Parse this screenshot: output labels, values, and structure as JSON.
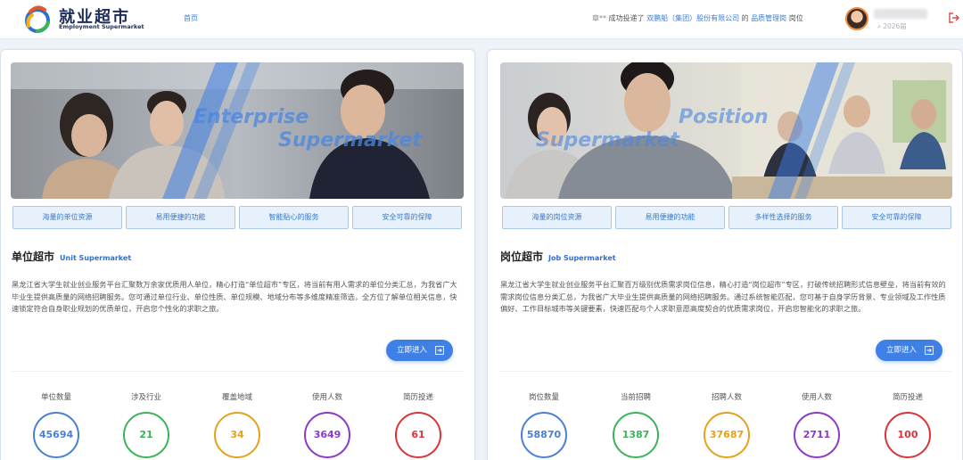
{
  "header": {
    "logo_title": "就业超市",
    "logo_subtitle": "Employment Supermarket",
    "nav_home": "首页",
    "ticker": {
      "user": "章**",
      "text1": "成功投递了",
      "company": "双鹏船（集团）股份有限公司",
      "text2": "的",
      "position": "品质管理岗",
      "text3": "岗位"
    },
    "user_meta": "2026届"
  },
  "unit": {
    "banner_text": [
      "Enterprise",
      "Supermarket"
    ],
    "features": [
      "海量的单位资源",
      "易用便捷的功能",
      "智能贴心的服务",
      "安全可靠的保障"
    ],
    "title": "单位超市",
    "title_en": "Unit Supermarket",
    "description": "黑龙江省大学生就业创业服务平台汇聚数万余家优质用人单位，精心打造“单位超市”专区，将当前有用人需求的单位分类汇总，为我省广大毕业生提供高质量的网络招聘服务。您可通过单位行业、单位性质、单位规模、地域分布等多维度精准筛选，全方位了解单位相关信息，快速锁定符合自身职业规划的优质单位，开启您个性化的求职之旅。",
    "enter_label": "立即进入",
    "stats": [
      {
        "label": "单位数量",
        "value": "45694",
        "color": "#4a7fd6"
      },
      {
        "label": "涉及行业",
        "value": "21",
        "color": "#3cb35a"
      },
      {
        "label": "覆盖地域",
        "value": "34",
        "color": "#e3a21b"
      },
      {
        "label": "使用人数",
        "value": "3649",
        "color": "#8c39c9"
      },
      {
        "label": "简历投递",
        "value": "61",
        "color": "#d8343a"
      }
    ]
  },
  "job": {
    "banner_text": [
      "Position",
      "Supermarket"
    ],
    "features": [
      "海量的岗位资源",
      "易用便捷的功能",
      "多样性选择的服务",
      "安全可靠的保障"
    ],
    "title": "岗位超市",
    "title_en": "Job Supermarket",
    "description": "黑龙江省大学生就业创业服务平台汇聚百万级别优质需求岗位信息，精心打造“岗位超市”专区，打破传统招聘形式信息壁垒，将当前有效的需求岗位信息分类汇总，为我省广大毕业生提供高质量的网络招聘服务。通过系统智能匹配，您可基于自身学历背景、专业领域及工作性质偏好、工作目标城市等关键要素，快速匹配与个人求职意愿高度契合的优质需求岗位，开启您智能化的求职之旅。",
    "enter_label": "立即进入",
    "stats": [
      {
        "label": "岗位数量",
        "value": "58870",
        "color": "#4a7fd6"
      },
      {
        "label": "当前招聘",
        "value": "1387",
        "color": "#3cb35a"
      },
      {
        "label": "招聘人数",
        "value": "37687",
        "color": "#e3a21b"
      },
      {
        "label": "使用人数",
        "value": "2711",
        "color": "#8c39c9"
      },
      {
        "label": "简历投递",
        "value": "100",
        "color": "#d8343a"
      }
    ]
  }
}
